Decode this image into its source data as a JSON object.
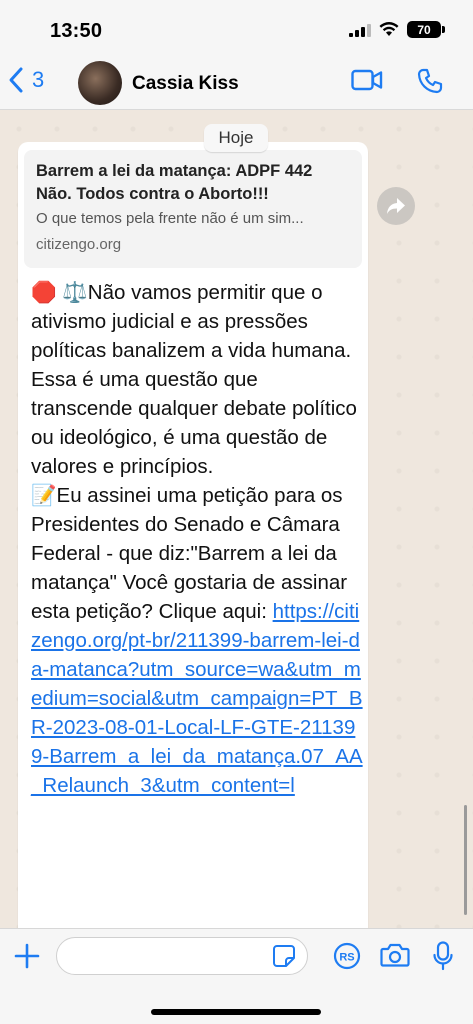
{
  "status_bar": {
    "time": "13:50",
    "battery": "70",
    "icons": [
      "signal-icon",
      "wifi-icon",
      "battery-icon"
    ]
  },
  "header": {
    "back_count": "3",
    "contact_name": "Cassia Kiss",
    "icons": [
      "chevron-left-icon",
      "video-icon",
      "phone-icon"
    ]
  },
  "chat": {
    "date_label": "Hoje",
    "preview": {
      "title": "Barrem a lei da matança: ADPF 442 Não. Todos contra o Aborto!!!",
      "description": "O que temos pela frente não é um sim...",
      "domain": "citizengo.org"
    },
    "message": {
      "emoji_stop": "🛑",
      "emoji_scales": "⚖️",
      "para1": "Não vamos permitir que o ativismo judicial e as pressões políticas banalizem a vida humana.",
      "para2": "Essa é uma questão que transcende qualquer debate político ou ideológico, é uma questão de valores e princípios.",
      "emoji_memo": "📝",
      "para3": "Eu assinei uma petição para os Presidentes do Senado e Câmara Federal - que diz:\"Barrem a lei da matança\" Você gostaria de assinar esta petição? Clique aqui: ",
      "link": "https://citizengo.org/pt-br/211399-barrem-lei-da-matanca?utm_source=wa&utm_medium=social&utm_campaign=PT_BR-2023-08-01-Local-LF-GTE-211399-Barrem_a_lei_da_matança.07_AA_Relaunch_3&utm_content=l"
    }
  },
  "input_bar": {
    "placeholder": "",
    "icons": [
      "plus-icon",
      "sticker-icon",
      "rs-icon",
      "camera-icon",
      "microphone-icon"
    ]
  },
  "colors": {
    "accent": "#1e7cf2",
    "link": "#1a73e8",
    "chat_bg": "#efe7de"
  }
}
